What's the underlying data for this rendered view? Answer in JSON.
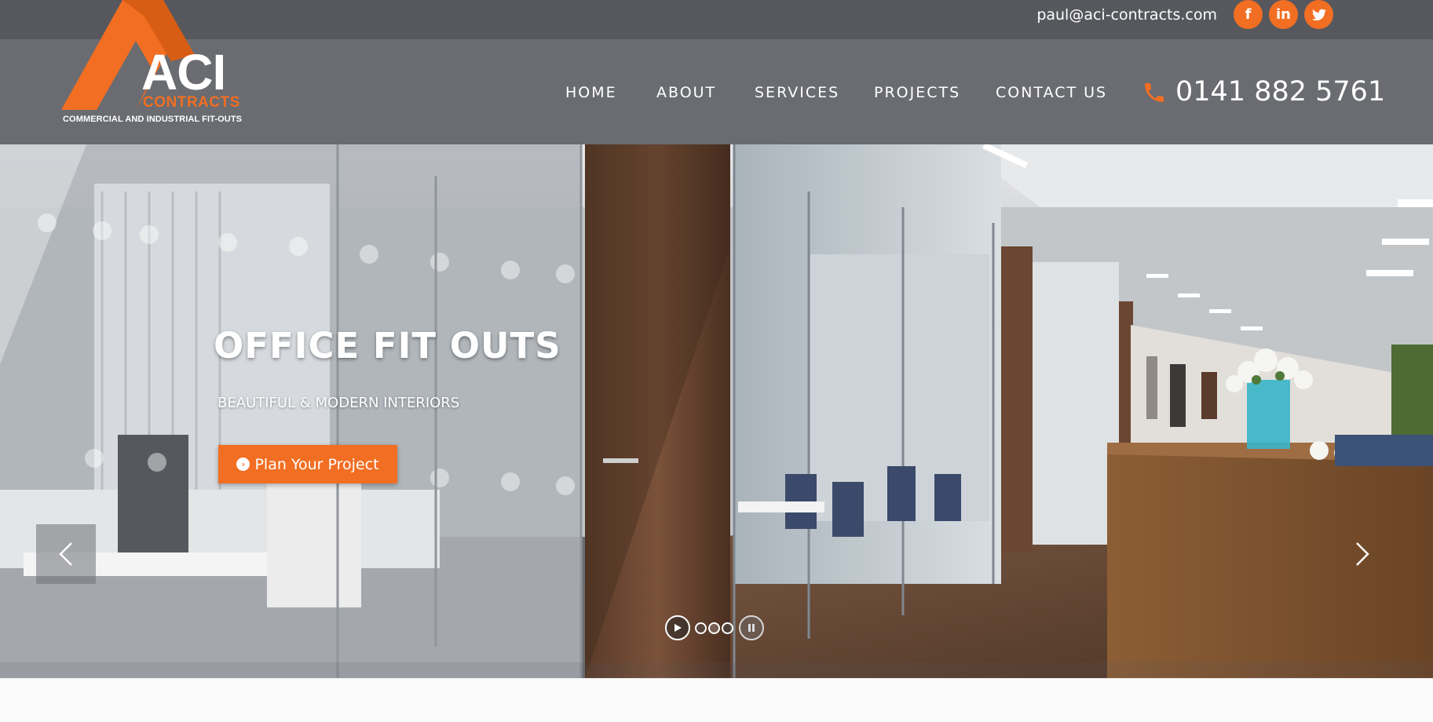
{
  "topbar": {
    "email": "paul@aci-contracts.com",
    "social": [
      {
        "name": "facebook-icon",
        "glyph": "f"
      },
      {
        "name": "linkedin-icon",
        "glyph": "in"
      },
      {
        "name": "twitter-icon",
        "glyph": "t"
      }
    ]
  },
  "logo": {
    "brand": "ACI",
    "sub": "CONTRACTS",
    "tagline": "COMMERCIAL AND INDUSTRIAL FIT-OUTS"
  },
  "nav": {
    "home": "HOME",
    "about": "ABOUT",
    "services": "SERVICES",
    "projects": "PROJECTS",
    "contact": "CONTACT US"
  },
  "phone": "0141 882 5761",
  "hero": {
    "title": "OFFICE FIT OUTS",
    "subtitle": "BEAUTIFUL & MODERN INTERIORS",
    "cta_label": "Plan Your Project",
    "slides_count": 3,
    "active_slide": 2
  },
  "colors": {
    "accent": "#f26e22",
    "topbar": "#56585d",
    "header": "#6a6c71"
  }
}
